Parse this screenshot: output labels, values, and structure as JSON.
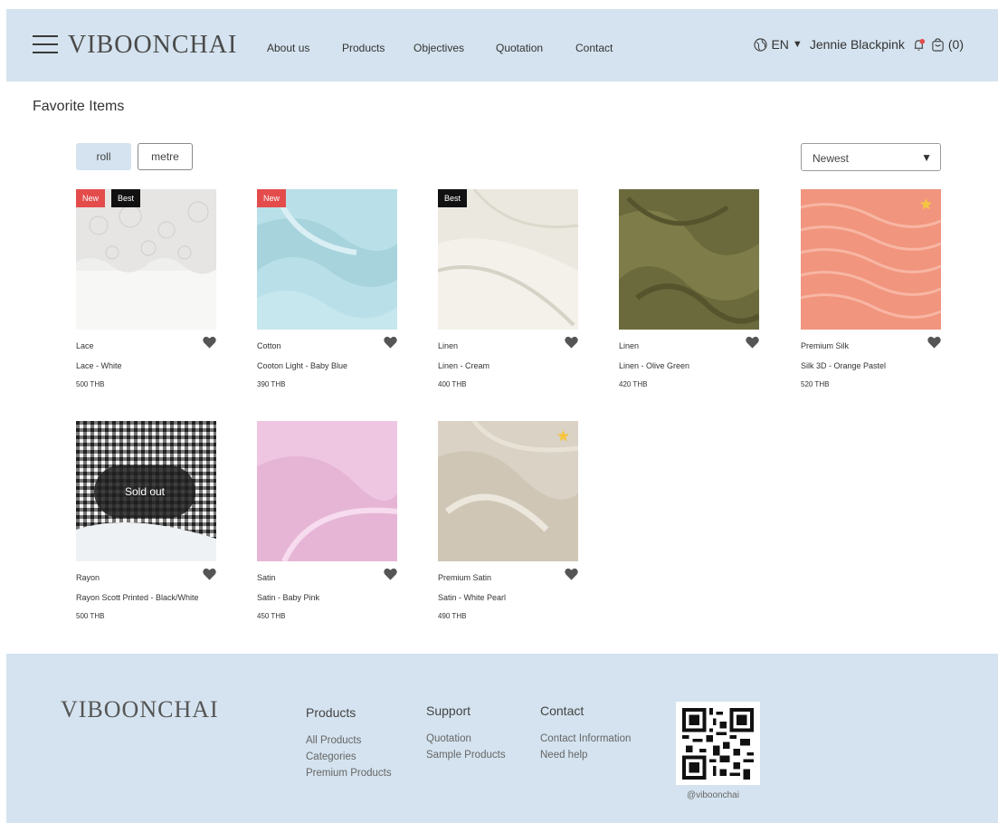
{
  "header": {
    "logo": "VIBOONCHAI",
    "nav": [
      "About us",
      "Products",
      "Objectives",
      "Quotation",
      "Contact"
    ],
    "language": "EN",
    "user": "Jennie Blackpink",
    "cart": "(0)"
  },
  "page": {
    "title": "Favorite Items",
    "units": [
      "roll",
      "metre"
    ],
    "sort": "Newest"
  },
  "products": [
    {
      "category": "Lace",
      "name": "Lace - White",
      "price": "500 THB",
      "badges": [
        "New",
        "Best"
      ],
      "starred": false,
      "sold_out": false
    },
    {
      "category": "Cotton",
      "name": "Cooton Light -  Baby Blue",
      "price": "390 THB",
      "badges": [
        "New"
      ],
      "starred": false,
      "sold_out": false
    },
    {
      "category": "Linen",
      "name": "Linen - Cream",
      "price": "400 THB",
      "badges": [
        "Best"
      ],
      "starred": false,
      "sold_out": false
    },
    {
      "category": "Linen",
      "name": "Linen - Olive Green",
      "price": "420 THB",
      "badges": [],
      "starred": false,
      "sold_out": false
    },
    {
      "category": "Premium Silk",
      "name": "Silk 3D - Orange Pastel",
      "price": "520 THB",
      "badges": [],
      "starred": true,
      "sold_out": false
    },
    {
      "category": "Rayon",
      "name": "Rayon Scott Printed - Black/White",
      "price": "500 THB",
      "badges": [],
      "starred": false,
      "sold_out": true,
      "sold_out_label": "Sold out"
    },
    {
      "category": "Satin",
      "name": "Satin - Baby Pink",
      "price": "450 THB",
      "badges": [],
      "starred": false,
      "sold_out": false
    },
    {
      "category": "Premium Satin",
      "name": "Satin - White Pearl",
      "price": "490 THB",
      "badges": [],
      "starred": true,
      "sold_out": false
    }
  ],
  "footer": {
    "logo": "VIBOONCHAI",
    "columns": [
      {
        "title": "Products",
        "links": [
          "All Products",
          "Categories",
          "Premium Products"
        ]
      },
      {
        "title": "Support",
        "links": [
          "Quotation",
          "Sample Products"
        ]
      },
      {
        "title": "Contact",
        "links": [
          "Contact Information",
          "Need help"
        ]
      }
    ],
    "social_handle": "@viboonchai"
  },
  "colors": {
    "brand_bg": "#d4e3ef",
    "badge_new": "#e44c4c",
    "badge_best": "#111111",
    "star": "#f5c542"
  }
}
